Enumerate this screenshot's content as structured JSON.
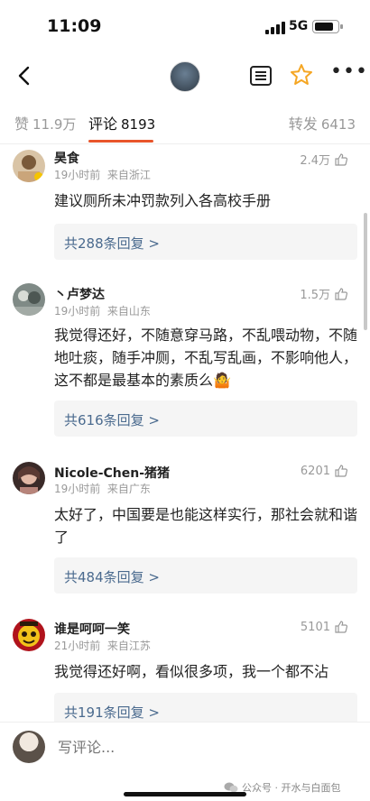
{
  "status": {
    "time": "11:09",
    "network": "5G",
    "battery_level": 0.85
  },
  "header": {
    "back_icon": "chevron-left-icon",
    "more_icon": "ellipsis-icon",
    "star_color": "#f5a623"
  },
  "tabs": {
    "likes": {
      "label": "赞",
      "count": "11.9万"
    },
    "comments": {
      "label": "评论",
      "count": "8193"
    },
    "reposts": {
      "label": "转发",
      "count": "6413"
    },
    "active_color": "#e8552b"
  },
  "comments": [
    {
      "user": "昊食",
      "time": "19小时前",
      "location": "来自浙江",
      "likes": "2.4万",
      "text": "建议厕所未冲罚款列入各高校手册",
      "replies": "共288条回复 >"
    },
    {
      "user": "丶卢梦达",
      "time": "19小时前",
      "location": "来自山东",
      "likes": "1.5万",
      "text": "我觉得还好，不随意穿马路，不乱喂动物，不随地吐痰，随手冲厕，不乱写乱画，不影响他人，这不都是最基本的素质么🤷",
      "replies": "共616条回复 >"
    },
    {
      "user": "Nicole-Chen-猪猪",
      "time": "19小时前",
      "location": "来自广东",
      "likes": "6201",
      "text": "太好了，中国要是也能这样实行，那社会就和谐了",
      "replies": "共484条回复 >"
    },
    {
      "user": "谁是呵呵一笑",
      "time": "21小时前",
      "location": "来自江苏",
      "likes": "5101",
      "text": "我觉得还好啊，看似很多项，我一个都不沾",
      "replies": "共191条回复 >"
    }
  ],
  "composer": {
    "placeholder": "写评论..."
  },
  "watermark": "公众号 · 开水与白面包",
  "reply_link_color": "#4a6a8e"
}
